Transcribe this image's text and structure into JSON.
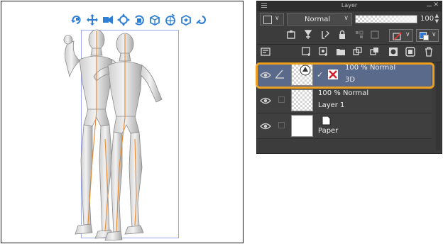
{
  "canvas": {
    "toolbar_icons": [
      "rotate-camera-icon",
      "pan-camera-icon",
      "dolly-camera-icon",
      "move-object-icon",
      "rotate-object-icon",
      "rotate-x-icon",
      "rotate-y-icon",
      "rotate-z-icon",
      "snap-icon"
    ]
  },
  "panel": {
    "title": "Layer",
    "blend_mode": "Normal",
    "opacity": "100",
    "opacity_fraction": 1.0
  },
  "layers": [
    {
      "opacity_mode": "100 % Normal",
      "name": "3D",
      "selected": true
    },
    {
      "opacity_mode": "100 % Normal",
      "name": "Layer 1",
      "selected": false
    },
    {
      "opacity_mode": "",
      "name": "Paper",
      "selected": false
    }
  ],
  "colors": {
    "accent_highlight": "#f0a020",
    "panel_bg": "#3c3c3c",
    "selected_row": "#5a6a8a",
    "toolbar_blue": "#2f7fd6"
  }
}
